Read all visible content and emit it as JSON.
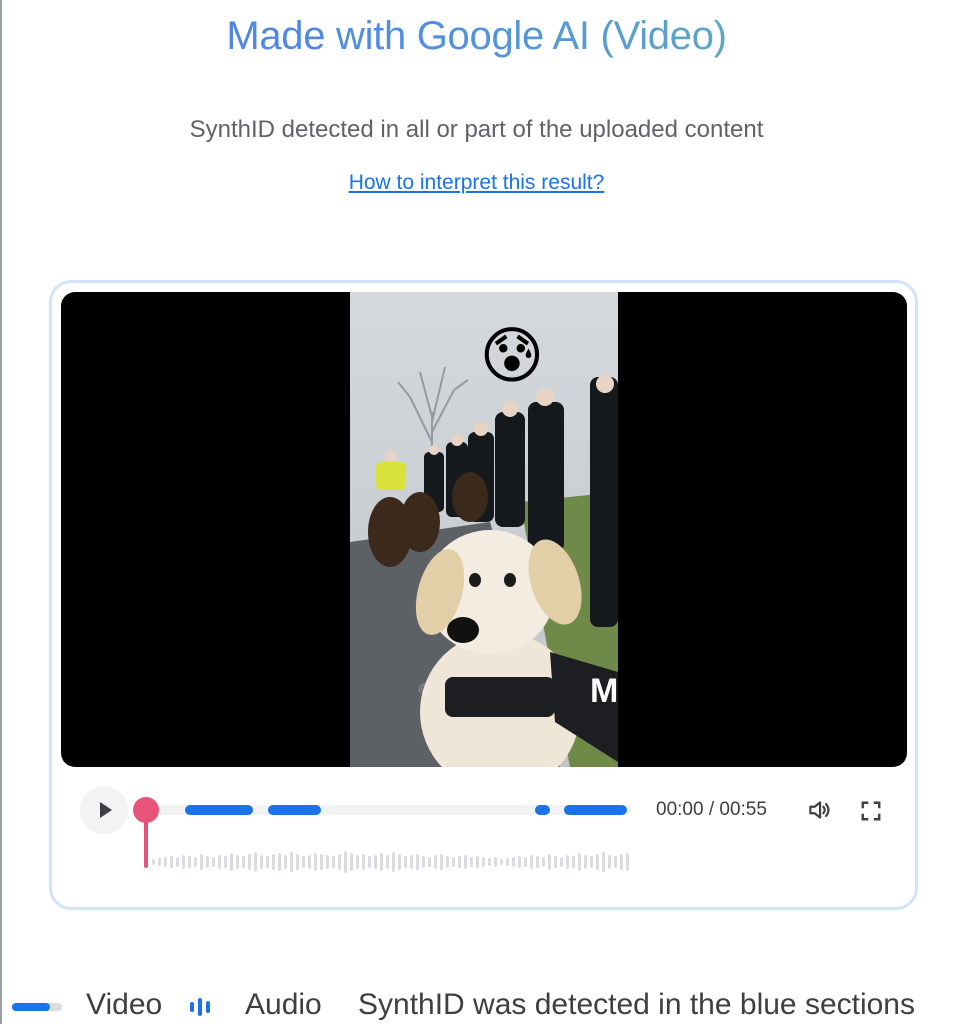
{
  "header": {
    "title": "Made with Google AI (Video)",
    "subtitle": "SynthID detected in all or part of the uploaded content",
    "help_link": "How to interpret this result?"
  },
  "player": {
    "video_watermark": "@",
    "emoji": "😰",
    "time_display": "00:00 / 00:55",
    "progress": 0,
    "detected_video_sections": [
      {
        "start": 0.08,
        "end": 0.22
      },
      {
        "start": 0.25,
        "end": 0.36
      },
      {
        "start": 0.8,
        "end": 0.83
      },
      {
        "start": 0.86,
        "end": 0.99
      }
    ]
  },
  "legend": {
    "video_label": "Video",
    "audio_label": "Audio",
    "note": "SynthID was detected in the blue sections"
  },
  "colors": {
    "detected": "#1a73e8",
    "playhead": "#e8537a",
    "card_border": "#d2e3fc"
  },
  "icons": [
    "play-icon",
    "volume-icon",
    "fullscreen-icon"
  ]
}
